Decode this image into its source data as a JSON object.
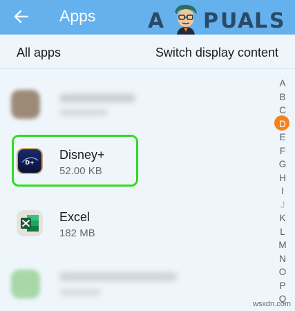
{
  "header": {
    "back_icon": "arrow-left-icon",
    "title": "Apps",
    "logo_letters": [
      "A",
      "P",
      "U",
      "A",
      "L",
      "S"
    ]
  },
  "subheader": {
    "all_apps": "All apps",
    "switch_display": "Switch display content"
  },
  "apps": [
    {
      "name": "Disney+",
      "size": "52.00 KB",
      "icon": "disney-plus-icon",
      "highlighted": true
    },
    {
      "name": "Excel",
      "size": "182 MB",
      "icon": "excel-icon",
      "highlighted": false
    }
  ],
  "index": {
    "letters": [
      "A",
      "B",
      "C",
      "D",
      "E",
      "F",
      "G",
      "H",
      "I",
      "J",
      "K",
      "L",
      "M",
      "N",
      "O",
      "P",
      "Q"
    ],
    "active": "D",
    "dimmed": [
      "J"
    ]
  },
  "watermark": "wsxdn.com",
  "colors": {
    "appbar": "#64b1ee",
    "background": "#eef6fc",
    "highlight": "#2ede1d",
    "index_active": "#f7821d"
  }
}
